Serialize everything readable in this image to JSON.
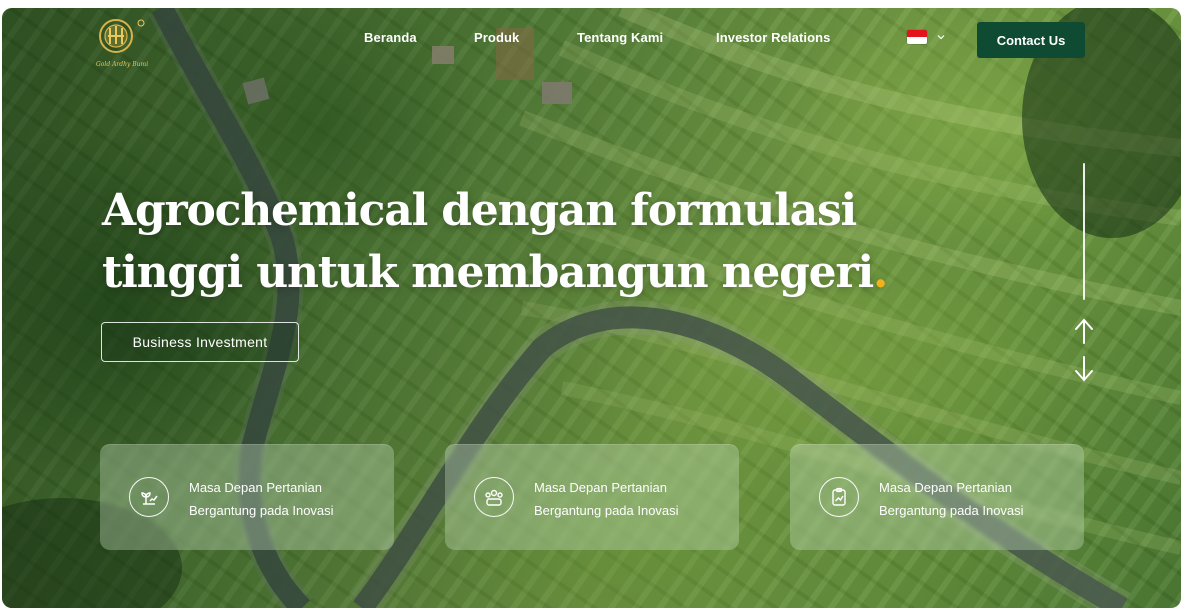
{
  "nav": {
    "links": [
      "Beranda",
      "Produk",
      "Tentang Kami",
      "Investor Relations"
    ],
    "language_flag": "Indonesia",
    "contact_label": "Contact Us",
    "logo_text": "Gold Ardhy Bumi"
  },
  "hero": {
    "title_line1": "Agrochemical dengan formulasi",
    "title_line2": "tinggi untuk membangun negeri",
    "title_dot": ".",
    "cta_label": "Business Investment"
  },
  "cards": [
    {
      "line1": "Masa Depan Pertanian",
      "line2": "Bergantung pada Inovasi",
      "icon": "plant-growth-icon"
    },
    {
      "line1": "Masa Depan Pertanian",
      "line2": "Bergantung pada Inovasi",
      "icon": "team-people-icon"
    },
    {
      "line1": "Masa Depan Pertanian",
      "line2": "Bergantung pada Inovasi",
      "icon": "report-chart-icon"
    }
  ],
  "colors": {
    "contact_bg": "#0f4a32",
    "accent_dot": "#f2b21a",
    "text": "#ffffff"
  }
}
